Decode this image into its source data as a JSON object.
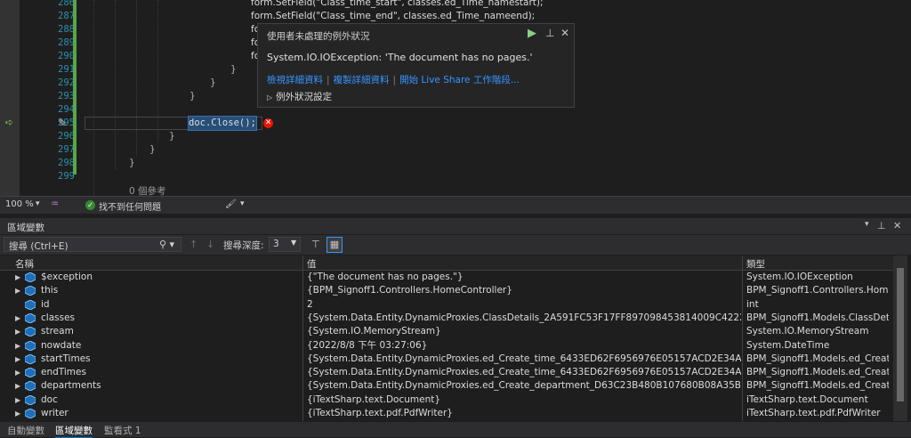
{
  "editor": {
    "lines": [
      {
        "num": "286",
        "code": "form.SetField(\"Class_time_start\", classes.ed_Time_namestart);"
      },
      {
        "num": "287",
        "code": "form.SetField(\"Class_time_end\", classes.ed_Time_nameend);"
      },
      {
        "num": "288",
        "code": "fo"
      },
      {
        "num": "289",
        "code": "fo"
      },
      {
        "num": "290",
        "code": "fo"
      },
      {
        "num": "291",
        "code": "}"
      },
      {
        "num": "292",
        "code": "}"
      },
      {
        "num": "293",
        "code": "}"
      },
      {
        "num": "294",
        "code": ""
      },
      {
        "num": "295",
        "code": "doc.Close();"
      },
      {
        "num": "296",
        "code": "}"
      },
      {
        "num": "297",
        "code": "}"
      },
      {
        "num": "298",
        "code": "}"
      },
      {
        "num": "299",
        "code": ""
      }
    ],
    "references": "0 個參考"
  },
  "exception": {
    "title": "使用者未處理的例外狀況",
    "message": "System.IO.IOException: 'The document has no pages.'",
    "links": [
      "檢視詳細資料",
      "複製詳細資料",
      "開始 Live Share 工作階段..."
    ],
    "settings": "例外狀況設定"
  },
  "status": {
    "zoom": "100 %",
    "issues": "找不到任何問題"
  },
  "locals": {
    "title": "區域變數",
    "search_placeholder": "搜尋 (Ctrl+E)",
    "depth_label": "搜尋深度:",
    "depth_value": "3",
    "columns": [
      "名稱",
      "值",
      "類型"
    ],
    "rows": [
      {
        "name": "$exception",
        "value": "{\"The document has no pages.\"}",
        "type": "System.IO.IOException",
        "expandable": true
      },
      {
        "name": "this",
        "value": "{BPM_Signoff1.Controllers.HomeController}",
        "type": "BPM_Signoff1.Controllers.Hom...",
        "expandable": true
      },
      {
        "name": "id",
        "value": "2",
        "type": "int",
        "expandable": false
      },
      {
        "name": "classes",
        "value": "{System.Data.Entity.DynamicProxies.ClassDetails_2A591FC53F17FF897098453814009C42229876C6CC0C...",
        "type": "BPM_Signoff1.Models.ClassDeta...",
        "expandable": true
      },
      {
        "name": "stream",
        "value": "{System.IO.MemoryStream}",
        "type": "System.IO.MemoryStream",
        "expandable": true
      },
      {
        "name": "nowdate",
        "value": "{2022/8/8 下午 03:27:06}",
        "type": "System.DateTime",
        "expandable": true
      },
      {
        "name": "startTimes",
        "value": "{System.Data.Entity.DynamicProxies.ed_Create_time_6433ED62F6956976E05157ACD2E34AC5364921E4F...",
        "type": "BPM_Signoff1.Models.ed_Creat...",
        "expandable": true
      },
      {
        "name": "endTimes",
        "value": "{System.Data.Entity.DynamicProxies.ed_Create_time_6433ED62F6956976E05157ACD2E34AC5364921E4F...",
        "type": "BPM_Signoff1.Models.ed_Creat...",
        "expandable": true
      },
      {
        "name": "departments",
        "value": "{System.Data.Entity.DynamicProxies.ed_Create_department_D63C23B480B107680B08A35B0C73B141AE...",
        "type": "BPM_Signoff1.Models.ed_Creat...",
        "expandable": true
      },
      {
        "name": "doc",
        "value": "{iTextSharp.text.Document}",
        "type": "iTextSharp.text.Document",
        "expandable": true
      },
      {
        "name": "writer",
        "value": "{iTextSharp.text.pdf.PdfWriter}",
        "type": "iTextSharp.text.pdf.PdfWriter",
        "expandable": true
      }
    ]
  },
  "bottom_tabs": [
    "自動變數",
    "區域變數",
    "監看式 1"
  ],
  "active_tab": 1,
  "colors": {
    "accent": "#007acc",
    "error": "#e51400",
    "link": "#3794ff"
  }
}
